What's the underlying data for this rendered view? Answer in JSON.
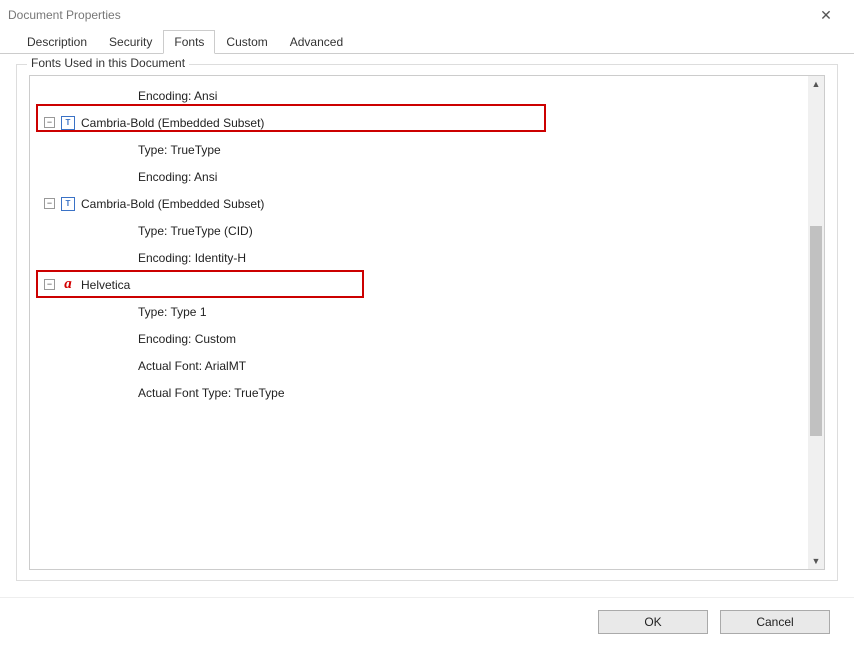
{
  "window": {
    "title": "Document Properties"
  },
  "tabs": {
    "items": [
      "Description",
      "Security",
      "Fonts",
      "Custom",
      "Advanced"
    ],
    "active_index": 2
  },
  "fieldset": {
    "legend": "Fonts Used in this Document"
  },
  "tree": {
    "rows": [
      {
        "kind": "child",
        "text": "Encoding: Ansi"
      },
      {
        "kind": "parent",
        "icon": "tt",
        "text": "Cambria-Bold (Embedded Subset)"
      },
      {
        "kind": "child",
        "text": "Type: TrueType"
      },
      {
        "kind": "child",
        "text": "Encoding: Ansi"
      },
      {
        "kind": "parent",
        "icon": "tt",
        "text": "Cambria-Bold (Embedded Subset)"
      },
      {
        "kind": "child",
        "text": "Type: TrueType (CID)"
      },
      {
        "kind": "child",
        "text": "Encoding: Identity-H"
      },
      {
        "kind": "parent",
        "icon": "a",
        "text": "Helvetica"
      },
      {
        "kind": "child",
        "text": "Type: Type 1"
      },
      {
        "kind": "child",
        "text": "Encoding: Custom"
      },
      {
        "kind": "child",
        "text": "Actual Font: ArialMT"
      },
      {
        "kind": "child",
        "text": "Actual Font Type: TrueType"
      }
    ]
  },
  "toggle_glyph": "−",
  "icons": {
    "tt": "T",
    "a": "a"
  },
  "buttons": {
    "ok": "OK",
    "cancel": "Cancel"
  },
  "close_glyph": "✕",
  "arrows": {
    "up": "▲",
    "down": "▼"
  }
}
